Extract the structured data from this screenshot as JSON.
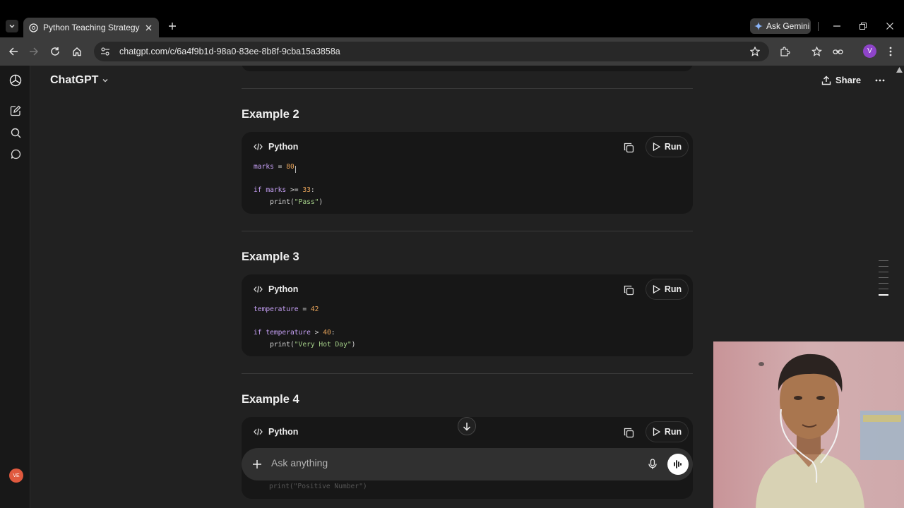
{
  "browser": {
    "tab_title": "Python Teaching Strategy",
    "url": "chatgpt.com/c/6a4f9b1d-98a0-83ee-8b8f-9cba15a3858a",
    "gemini_label": "Ask Gemini",
    "profile_initial": "V"
  },
  "app": {
    "brand": "ChatGPT",
    "share_label": "Share",
    "user_initials": "VE"
  },
  "sections": [
    {
      "heading": "Example 2",
      "lang": "Python",
      "run_label": "Run"
    },
    {
      "heading": "Example 3",
      "lang": "Python",
      "run_label": "Run"
    },
    {
      "heading": "Example 4",
      "lang": "Python",
      "run_label": "Run"
    }
  ],
  "code": {
    "ex2": {
      "l1_var": "marks",
      "l1_op": " = ",
      "l1_num": "80",
      "l3_kw": "if ",
      "l3_var": "marks",
      "l3_op": " >= ",
      "l3_num": "33",
      "l3_end": ":",
      "l4_fn": "    print(",
      "l4_str": "\"Pass\"",
      "l4_end": ")"
    },
    "ex3": {
      "l1_var": "temperature",
      "l1_op": " = ",
      "l1_num": "42",
      "l3_kw": "if ",
      "l3_var": "temperature",
      "l3_op": " > ",
      "l3_num": "40",
      "l3_end": ":",
      "l4_fn": "    print(",
      "l4_str": "\"Very Hot Day\"",
      "l4_end": ")"
    },
    "ex4_partial": "print(\"Positive Number\")"
  },
  "composer": {
    "placeholder": "Ask anything"
  },
  "colors": {
    "page_bg": "#212121",
    "code_bg": "#171717",
    "keyword": "#c6a0f6",
    "number": "#e8a45a",
    "string": "#a6d28a",
    "avatar": "#e0593e",
    "profile": "#8e44c9"
  },
  "icons": {
    "tab_menu": "chevron-down-icon",
    "new_tab": "plus-icon",
    "back": "arrow-left-icon",
    "forward": "arrow-right-icon",
    "reload": "reload-icon",
    "home": "home-icon",
    "bookmark": "star-icon",
    "extensions": "puzzle-icon",
    "code_lang": "code-icon",
    "copy": "copy-icon",
    "run": "play-icon",
    "share": "upload-icon",
    "jump": "arrow-down-icon",
    "mic": "mic-icon",
    "voice": "waveform-icon"
  }
}
